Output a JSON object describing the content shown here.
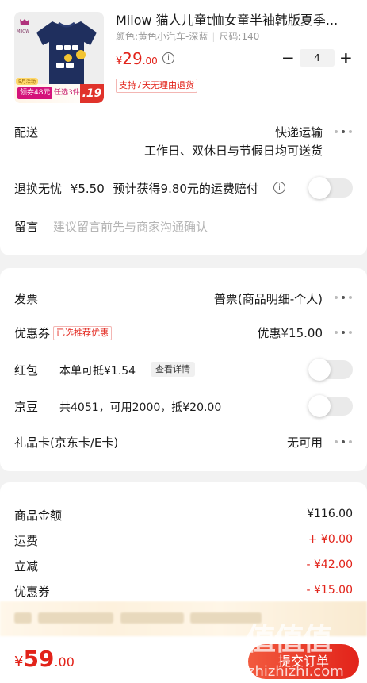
{
  "product": {
    "title": "Miiow 猫人儿童t恤女童半袖韩版夏季...",
    "spec_color": "颜色:黄色小汽车-深蓝",
    "spec_size": "尺码:140",
    "price_currency": "¥",
    "price_int": "29",
    "price_dec": ".00",
    "quantity": "4",
    "minus": "−",
    "plus": "+",
    "return_tag": "支持7天无理由退货",
    "thumb_brand": "MIIOW",
    "thumb_shirt_text": "LET'S GO EAT!",
    "promo_top": "5月活动",
    "promo_coupon": "领券48元",
    "promo_pick": "任选3件",
    "promo_price": ".19"
  },
  "delivery": {
    "label": "配送",
    "method": "快递运输",
    "schedule": "工作日、双休日与节假日均可送货"
  },
  "return_insurance": {
    "label": "退换无忧",
    "price": "¥5.50",
    "desc": "预计获得9.80元的运费赔付"
  },
  "note": {
    "label": "留言",
    "placeholder": "建议留言前先与商家沟通确认"
  },
  "invoice": {
    "label": "发票",
    "value": "普票(商品明细-个人)"
  },
  "coupon": {
    "label": "优惠券",
    "tag": "已选推荐优惠",
    "value": "优惠¥15.00"
  },
  "red_packet": {
    "label": "红包",
    "desc": "本单可抵¥1.54",
    "detail_button": "查看详情"
  },
  "jingdou": {
    "label": "京豆",
    "desc": "共4051，可用2000，抵¥20.00"
  },
  "gift_card": {
    "label": "礼品卡(京东卡/E卡)",
    "value": "无可用"
  },
  "summary": {
    "items": [
      {
        "label": "商品金额",
        "value": "¥116.00",
        "color": "#1a1a1a"
      },
      {
        "label": "运费",
        "value": "+ ¥0.00",
        "color": "#e2231a"
      },
      {
        "label": "立减",
        "value": "- ¥42.00",
        "color": "#e2231a"
      },
      {
        "label": "优惠券",
        "value": "- ¥15.00",
        "color": "#e2231a"
      }
    ]
  },
  "footer": {
    "total_currency": "¥",
    "total_int": "59",
    "total_dec": ".00",
    "submit": "提交订单"
  },
  "watermark": {
    "main": "值值值",
    "sub": "zhizhizhi.com"
  },
  "colors": {
    "accent": "#e2231a",
    "background": "#f2f2f2"
  }
}
